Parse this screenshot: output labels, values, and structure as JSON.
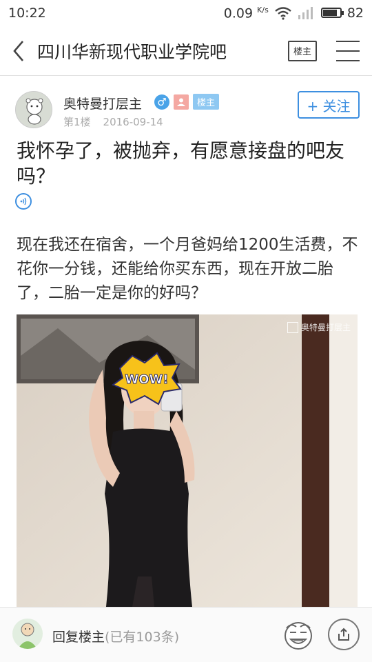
{
  "status_bar": {
    "time": "10:22",
    "net_speed": "0.09",
    "net_unit": "K/s",
    "battery_level": "82",
    "icons": [
      "wifi-icon",
      "signal-icon",
      "battery-icon"
    ]
  },
  "title_bar": {
    "back_icon": "back-chevron-icon",
    "title": "四川华新现代职业学院吧",
    "lz_button": "楼主",
    "menu_icon": "menu-icon"
  },
  "author": {
    "name": "奥特曼打层主",
    "badge_label": "楼主",
    "floor": "第1楼",
    "date": "2016-09-14",
    "follow_label": "+ 关注",
    "icons": [
      "male-gender-icon",
      "user-profile-icon"
    ]
  },
  "post": {
    "title": "我怀孕了，被抛弃，有愿意接盘的吧友吗？",
    "audio_icon": "audio-icon",
    "body": "现在我还在宿舍，一个月爸妈给1200生活费，不花你一分钱，还能给你买东西，现在开放二胎了，二胎一定是你的好吗？",
    "image_watermark": "奥特曼打层主",
    "image_sticker": "WOW!"
  },
  "bottom_bar": {
    "reply_label": "回复楼主",
    "reply_count": "(已有103条)",
    "emoji_icon": "emoji-icon",
    "share_icon": "share-icon"
  },
  "colors": {
    "accent_blue": "#3d8fe0",
    "badge_blue": "#8ec8f2",
    "gender_blue": "#4aa3e8",
    "user_pink": "#f4a8a2"
  }
}
